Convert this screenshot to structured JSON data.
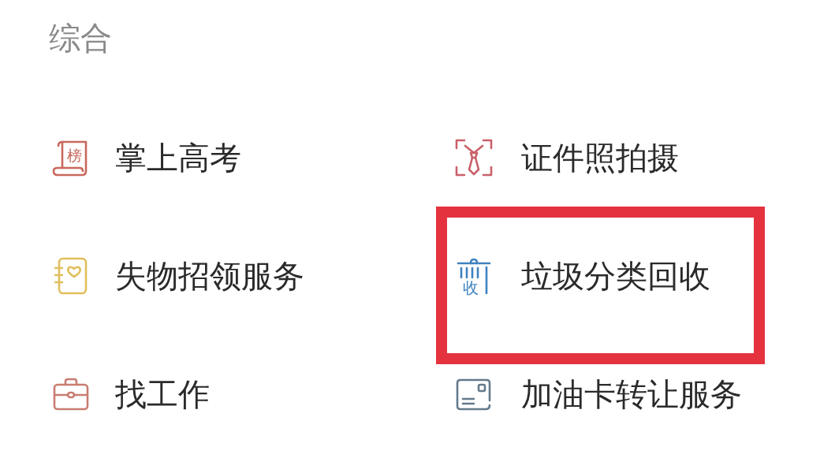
{
  "section": {
    "title": "综合"
  },
  "items": [
    {
      "kind": "scroll",
      "icon_text": "榜",
      "label": "掌上高考",
      "highlighted": false
    },
    {
      "kind": "tie",
      "label": "证件照拍摄",
      "highlighted": false
    },
    {
      "kind": "notebook",
      "label": "失物招领服务",
      "highlighted": false
    },
    {
      "kind": "trash",
      "icon_text": "收",
      "label": "垃圾分类回收",
      "highlighted": true
    },
    {
      "kind": "briefcase",
      "label": "找工作",
      "highlighted": false
    },
    {
      "kind": "card",
      "label": "加油卡转让服务",
      "highlighted": false
    }
  ]
}
